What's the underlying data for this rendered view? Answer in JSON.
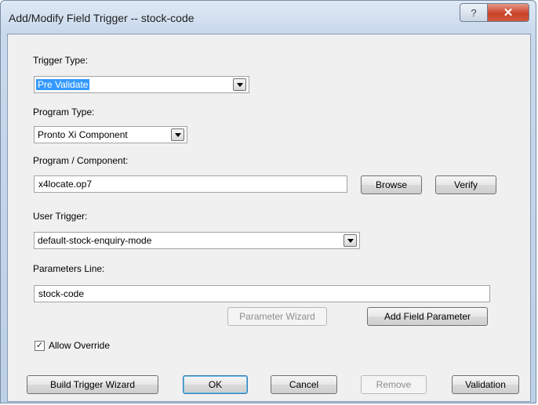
{
  "window": {
    "title": "Add/Modify Field Trigger -- stock-code",
    "help_glyph": "?",
    "close_glyph": "✕"
  },
  "form": {
    "trigger_type": {
      "label": "Trigger Type:",
      "value": "Pre Validate"
    },
    "program_type": {
      "label": "Program Type:",
      "value": "Pronto Xi Component"
    },
    "program_component": {
      "label": "Program / Component:",
      "value": "x4locate.op7"
    },
    "user_trigger": {
      "label": "User Trigger:",
      "value": "default-stock-enquiry-mode"
    },
    "parameters_line": {
      "label": "Parameters Line:",
      "value": "stock-code"
    },
    "allow_override": {
      "label": "Allow Override",
      "checked": true,
      "check_glyph": "✓"
    }
  },
  "buttons": {
    "browse": "Browse",
    "verify": "Verify",
    "parameter_wizard": "Parameter Wizard",
    "add_field_parameter": "Add Field Parameter",
    "build_trigger_wizard": "Build Trigger Wizard",
    "ok": "OK",
    "cancel": "Cancel",
    "remove": "Remove",
    "validation": "Validation"
  }
}
